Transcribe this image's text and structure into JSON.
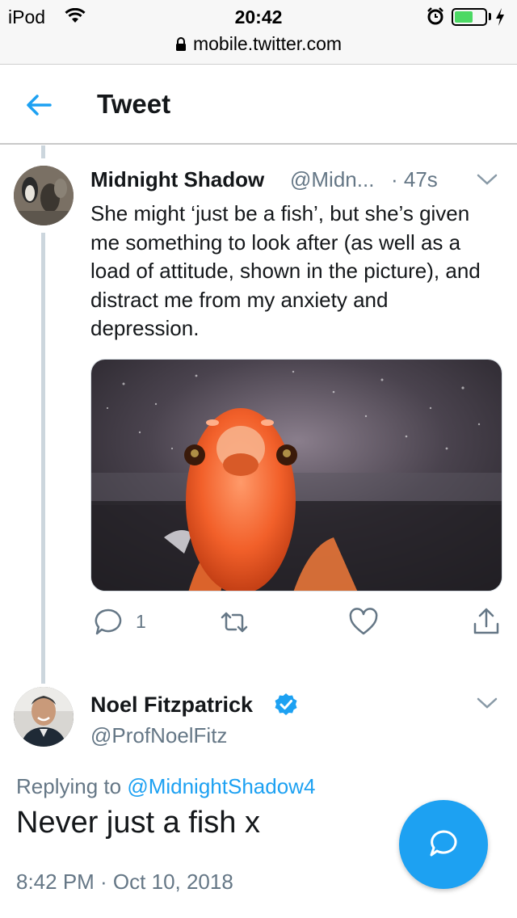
{
  "status_bar": {
    "device": "iPod",
    "time": "20:42",
    "url": "mobile.twitter.com"
  },
  "header": {
    "title": "Tweet"
  },
  "tweets": [
    {
      "name": "Midnight Shadow",
      "handle": "@Midn...",
      "time": "· 47s",
      "text": "She might ‘just be a fish’, but she’s given me something to look after (as well as a load of attitude, shown in the picture), and distract me from my anxiety and depression.",
      "reply_count": "1"
    },
    {
      "name": "Noel Fitzpatrick",
      "handle": "@ProfNoelFitz",
      "replying_prefix": "Replying to",
      "replying_to": "@MidnightShadow4",
      "text": "Never just a fish x",
      "date": "8:42 PM · Oct 10, 2018"
    }
  ],
  "colors": {
    "accent": "#1da1f2",
    "secondary_text": "#657786",
    "thread_line": "#ccd6dd"
  },
  "icons": {
    "back": "arrow-left-icon",
    "reply": "reply-icon",
    "retweet": "retweet-icon",
    "like": "heart-icon",
    "share": "share-icon",
    "verified": "verified-badge-icon",
    "compose": "compose-reply-icon"
  }
}
